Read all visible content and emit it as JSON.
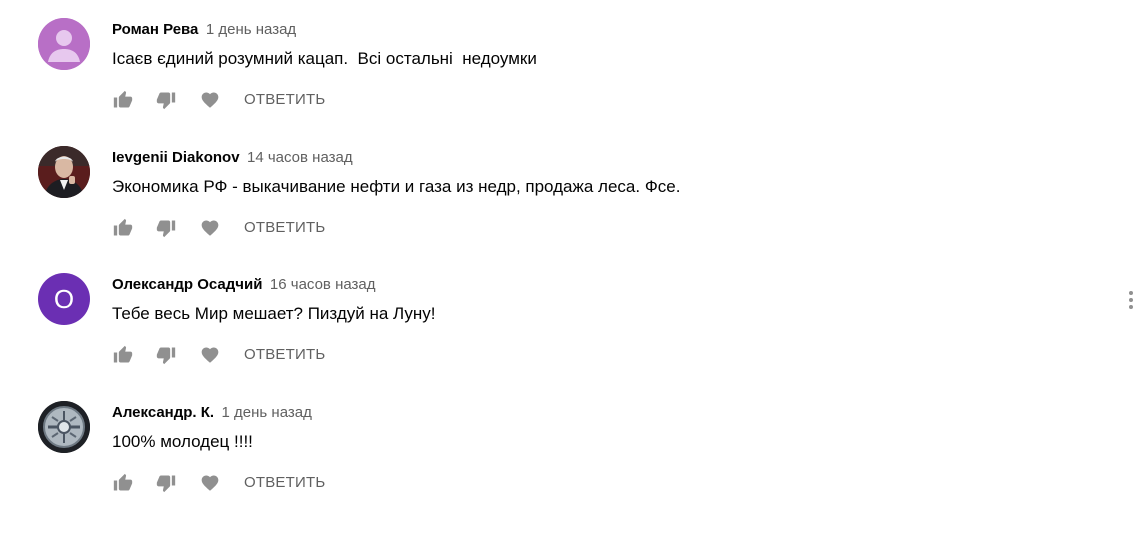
{
  "reply_label": "ОТВЕТИТЬ",
  "icons": {
    "like": "thumbs-up-icon",
    "dislike": "thumbs-down-icon",
    "heart": "heart-icon",
    "menu": "more-vert-icon"
  },
  "colors": {
    "author_text": "#030303",
    "meta_text": "#606060",
    "icon": "#909090",
    "avatar_roman": "#b86fc6",
    "avatar_oleksandr": "#6b2fb3"
  },
  "comments": [
    {
      "author": "Роман Рева",
      "time": "1 день назад",
      "text": "Ісаєв єдиний розумний кацап.  Всі остальні  недоумки"
    },
    {
      "author": "Ievgenii Diakonov",
      "time": "14 часов назад",
      "text": "Экономика РФ - выкачивание нефти и газа из недр, продажа леса. Фсе."
    },
    {
      "author": "Олександр Осадчий",
      "time": "16 часов назад",
      "text": "Тебе весь Мир мешает? Пиздуй на Луну!",
      "avatar_letter": "О"
    },
    {
      "author": "Александр. К.",
      "time": "1 день назад",
      "text": "100% молодец !!!!"
    }
  ]
}
